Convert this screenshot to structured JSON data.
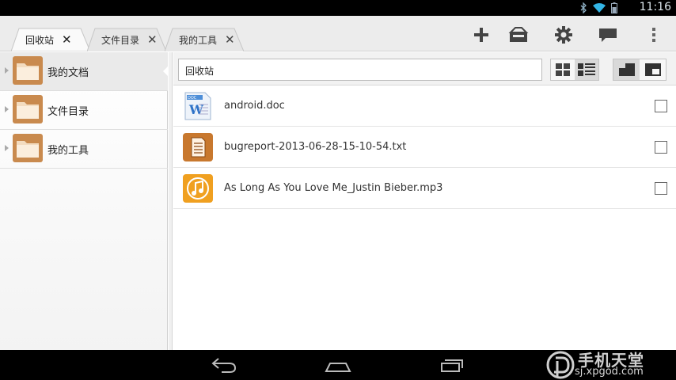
{
  "status_bar": {
    "time": "11:16",
    "icons": [
      "bluetooth-icon",
      "wifi-icon",
      "battery-icon"
    ]
  },
  "tabs": [
    {
      "label": "回收站",
      "active": true
    },
    {
      "label": "文件目录",
      "active": false
    },
    {
      "label": "我的工具",
      "active": false
    }
  ],
  "tab_close_glyph": "✕",
  "actions": [
    "add-icon",
    "toolbox-icon",
    "settings-icon",
    "chat-icon",
    "overflow-menu-icon"
  ],
  "sidebar": {
    "items": [
      {
        "label": "我的文档",
        "selected": true
      },
      {
        "label": "文件目录",
        "selected": false
      },
      {
        "label": "我的工具",
        "selected": false
      }
    ]
  },
  "path": {
    "value": "回收站"
  },
  "files": [
    {
      "name": "android.doc",
      "icon": "doc-file-icon"
    },
    {
      "name": "bugreport-2013-06-28-15-10-54.txt",
      "icon": "txt-file-icon"
    },
    {
      "name": "As Long As You Love Me_Justin Bieber.mp3",
      "icon": "music-file-icon"
    }
  ],
  "watermark": {
    "title": "手机天堂",
    "url": "sj.xpgod.com"
  },
  "colors": {
    "folder": "#d89a5a",
    "music": "#f0a020",
    "txt": "#c8782e"
  }
}
